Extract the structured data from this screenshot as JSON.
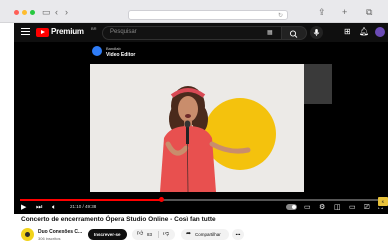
{
  "browser": {
    "nav_back": "‹",
    "nav_forward": "›"
  },
  "youtube": {
    "logo_text": "Premium",
    "logo_country": "BR",
    "search_placeholder": "Pesquisar",
    "accent_color": "#ff0000"
  },
  "overlay": {
    "app_top": "Bandlab",
    "app_name": "Video Editor"
  },
  "player": {
    "time_display": "21:10 / 49:38",
    "progress_fraction": 0.39,
    "side_chip": "K"
  },
  "video": {
    "title": "Concerto de encerramento Ópera Studio Online - Così fan tutte",
    "channel_name": "Duo Conexões C...",
    "channel_subs": "306 inscritos",
    "subscribe_label": "Inscrever-se",
    "likes": "83",
    "share_label": "Compartilhar"
  }
}
